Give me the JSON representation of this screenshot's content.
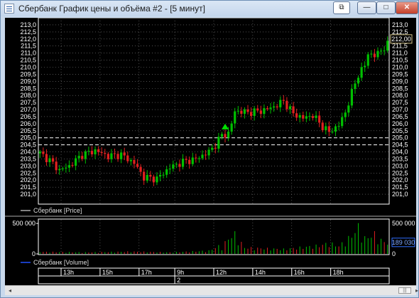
{
  "window": {
    "title": "Сбербанк График цены и объёма #2 - [5 минут]",
    "buttons": {
      "restore_doc": "⧉",
      "minimize": "—",
      "maximize": "□",
      "close": "✕"
    }
  },
  "colors": {
    "background": "#000000",
    "up": "#00c000",
    "down": "#e02020",
    "grid": "#808080",
    "signal": "#00e000",
    "volume_legend": "#2050ff"
  },
  "chart_data": {
    "type": "candlestick",
    "price_panel": {
      "legend": "Сбербанк [Price]",
      "ylim": [
        200.5,
        213.2
      ],
      "y_ticks": [
        "201,0",
        "201,5",
        "202,0",
        "202,5",
        "203,0",
        "203,5",
        "204,0",
        "204,5",
        "205,0",
        "205,5",
        "206,0",
        "206,5",
        "207,0",
        "207,5",
        "208,0",
        "208,5",
        "209,0",
        "209,5",
        "210,0",
        "210,5",
        "211,0",
        "211,5",
        "212,0",
        "212,5",
        "213,0"
      ],
      "current_value": "212,00",
      "current": 212.0,
      "dashed_levels": [
        205.0,
        204.5
      ],
      "signal_marker": 205.8,
      "path": [
        [
          0,
          203.9
        ],
        [
          3,
          203.4
        ],
        [
          6,
          202.7
        ],
        [
          9,
          203.0
        ],
        [
          13,
          203.8
        ],
        [
          17,
          204.1
        ],
        [
          21,
          203.7
        ],
        [
          25,
          203.8
        ],
        [
          29,
          203.2
        ],
        [
          32,
          202.2
        ],
        [
          36,
          202.1
        ],
        [
          40,
          202.9
        ],
        [
          44,
          203.3
        ],
        [
          48,
          203.5
        ],
        [
          52,
          204.0
        ],
        [
          54,
          204.5
        ],
        [
          56,
          205.2
        ],
        [
          58,
          205.3
        ],
        [
          59,
          206.0
        ],
        [
          60,
          206.9
        ],
        [
          64,
          206.8
        ],
        [
          68,
          206.9
        ],
        [
          72,
          207.2
        ],
        [
          75,
          207.6
        ],
        [
          78,
          206.7
        ],
        [
          81,
          206.4
        ],
        [
          84,
          206.6
        ],
        [
          87,
          205.8
        ],
        [
          89,
          205.4
        ],
        [
          92,
          205.9
        ],
        [
          94,
          206.8
        ],
        [
          96,
          208.2
        ],
        [
          98,
          209.5
        ],
        [
          100,
          210.1
        ],
        [
          101,
          211.0
        ],
        [
          103,
          210.8
        ],
        [
          105,
          211.2
        ],
        [
          107,
          211.6
        ],
        [
          108,
          212.0
        ]
      ]
    },
    "volume_panel": {
      "legend": "Сбербанк [Volume]",
      "y_ticks": [
        "500 000",
        "0"
      ],
      "y_tick_values": [
        500000,
        0
      ],
      "ylim": [
        0,
        560000
      ],
      "current_value": "189 030",
      "current": 189030,
      "path": [
        [
          0,
          40000
        ],
        [
          15,
          30000
        ],
        [
          28,
          45000
        ],
        [
          40,
          30000
        ],
        [
          52,
          60000
        ],
        [
          55,
          150000
        ],
        [
          56,
          130000
        ],
        [
          58,
          300000
        ],
        [
          60,
          380000
        ],
        [
          63,
          120000
        ],
        [
          75,
          90000
        ],
        [
          86,
          160000
        ],
        [
          89,
          210000
        ],
        [
          92,
          150000
        ],
        [
          96,
          350000
        ],
        [
          98,
          520000
        ],
        [
          100,
          300000
        ],
        [
          103,
          380000
        ],
        [
          105,
          260000
        ],
        [
          108,
          189030
        ]
      ]
    },
    "x_axis": {
      "labels": [
        "13h",
        "15h",
        "17h",
        "9h",
        "12h",
        "14h",
        "16h",
        "18h"
      ],
      "label_bars": [
        7,
        19,
        31,
        42,
        54,
        66,
        78,
        90
      ],
      "day_separator": {
        "label": "2",
        "bar": 42
      },
      "bar_count": 108
    }
  },
  "scrollbar": {
    "left_arrow": "◂",
    "right_arrow": "▸",
    "thumb": "|||"
  }
}
